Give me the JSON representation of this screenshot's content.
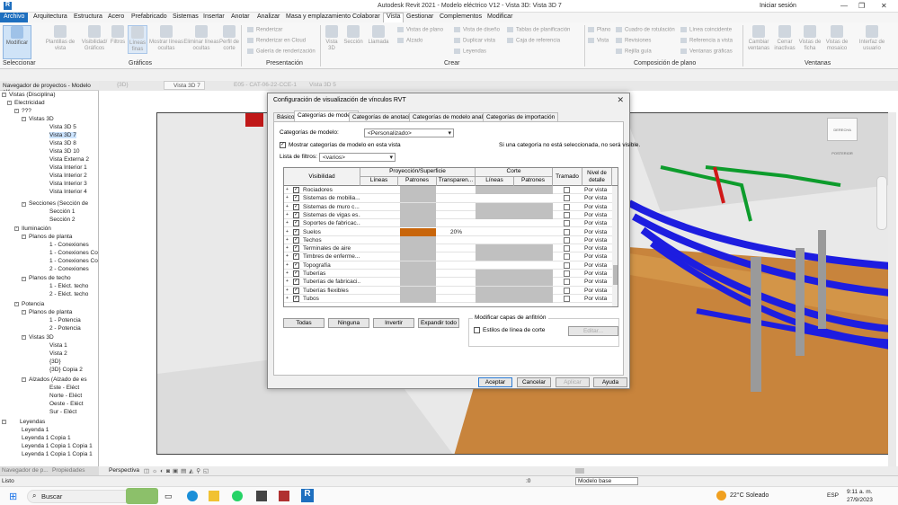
{
  "window": {
    "title": "Autodesk Revit 2021 - Modelo eléctrico V12 - Vista 3D: Vista 3D 7",
    "sign_in": "Iniciar sesión"
  },
  "ribbon_tabs": [
    "Archivo",
    "Arquitectura",
    "Estructura",
    "Acero",
    "Prefabricado",
    "Sistemas",
    "Insertar",
    "Anotar",
    "Analizar",
    "Masa y emplazamiento",
    "Colaborar",
    "Vista",
    "Gestionar",
    "Complementos",
    "Modificar"
  ],
  "ribbon": {
    "modificar": "Modificar",
    "seleccionar": "Seleccionar",
    "graficos": {
      "label": "Gráficos",
      "items": [
        "Plantillas de vista",
        "Visibilidad/ Gráficos",
        "Filtros",
        "Líneas finas",
        "Mostrar líneas ocultas",
        "Eliminar líneas ocultas",
        "Perfil de corte"
      ]
    },
    "presentacion": {
      "label": "Presentación",
      "items": [
        "Renderizar",
        "Renderizar en Cloud",
        "Galería de renderización"
      ]
    },
    "crear": {
      "label": "Crear",
      "big": [
        "Vista 3D",
        "Sección",
        "Llamada"
      ],
      "small": [
        "Vistas de plano",
        "Alzado",
        "Vista de diseño",
        "Duplicar vista",
        "Leyendas",
        "Tablas de planificación",
        "Caja de referencia"
      ]
    },
    "composicion": {
      "label": "Composición de plano",
      "small": [
        "Plano",
        "Vista",
        "Cuadro de rotulación",
        "Revisiones",
        "Rejilla guía",
        "Línea coincidente",
        "Referencia a vista",
        "Ventanas gráficas"
      ]
    },
    "ventanas": {
      "label": "Ventanas",
      "items": [
        "Cambiar ventanas",
        "Cerrar inactivas",
        "Vistas de ficha",
        "Vistas de mosaico",
        "Interfaz de usuario"
      ]
    }
  },
  "view_tabs": [
    "{3D}",
    "Vista 3D 7",
    "E05 - CAT-06-22-CCE-1",
    "Vista 3D 5"
  ],
  "browser": {
    "title": "Navegador de proyectos - Modelo elé...",
    "items": [
      "Vistas (Disciplina)",
      "Electricidad",
      "???",
      "Vistas 3D",
      "Vista 3D 5",
      "Vista 3D 7",
      "Vista 3D 8",
      "Vista 3D 10",
      "Vista Externa 2",
      "Vista Interior 1",
      "Vista Interior 2",
      "Vista Interior 3",
      "Vista Interior 4",
      "Secciones (Sección de",
      "Sección 1",
      "Sección 2",
      "Iluminación",
      "Planos de planta",
      "1 - Conexiones",
      "1 - Conexiones Co",
      "1 - Conexiones Co",
      "2 - Conexiones",
      "Planos de techo",
      "1 - Eléct. techo",
      "2 - Eléct. techo",
      "Potencia",
      "Planos de planta",
      "1 - Potencia",
      "2 - Potencia",
      "Vistas 3D",
      "Vista 1",
      "Vista 2",
      "{3D}",
      "{3D} Copia 2",
      "Alzados (Alzado de es",
      "Este - Eléct",
      "Norte - Eléct",
      "Oeste - Eléct",
      "Sur - Eléct",
      "Leyendas",
      "Leyenda 1",
      "Leyenda 1 Copia 1",
      "Leyenda 1 Copia 1 Copia 1",
      "Leyenda 1 Copia 1 Copia 1"
    ],
    "tabs": [
      "Navegador de p...",
      "Propiedades"
    ]
  },
  "dialog": {
    "title": "Configuración de visualización de vínculos RVT",
    "close": "✕",
    "tabs": [
      "Básicos",
      "Categorías de modelo",
      "Categorías de anotación",
      "Categorías de modelo analítico",
      "Categorías de importación"
    ],
    "model_categories_label": "Categorías de modelo:",
    "model_categories_value": "<Personalizado>",
    "show_label": "Mostrar categorías de modelo en esta vista",
    "note": "Si una categoría no está seleccionada, no será visible.",
    "filter_label": "Lista de filtros:",
    "filter_value": "<varios>",
    "columns": {
      "visibilidad": "Visibilidad",
      "proy": "Proyección/Superficie",
      "corte": "Corte",
      "lineas": "Líneas",
      "patrones": "Patrones",
      "transparencia": "Transparen...",
      "lineas2": "Líneas",
      "patrones2": "Patrones",
      "tramado": "Tramado",
      "nivel": "Nivel de detalle"
    },
    "rows": [
      {
        "name": "Rociadores",
        "detail": "Por vista",
        "cut": true,
        "transp": ""
      },
      {
        "name": "Sistemas de mobilia...",
        "detail": "Por vista",
        "cut": false,
        "transp": ""
      },
      {
        "name": "Sistemas de muro c...",
        "detail": "Por vista",
        "cut": true,
        "transp": ""
      },
      {
        "name": "Sistemas de vigas es...",
        "detail": "Por vista",
        "cut": true,
        "transp": ""
      },
      {
        "name": "Soportes de fabricac...",
        "detail": "Por vista",
        "cut": false,
        "transp": ""
      },
      {
        "name": "Suelos",
        "detail": "Por vista",
        "cut": false,
        "transp": "20%"
      },
      {
        "name": "Techos",
        "detail": "Por vista",
        "cut": false,
        "transp": ""
      },
      {
        "name": "Terminales de aire",
        "detail": "Por vista",
        "cut": true,
        "transp": ""
      },
      {
        "name": "Timbres de enferme...",
        "detail": "Por vista",
        "cut": true,
        "transp": ""
      },
      {
        "name": "Topografía",
        "detail": "Por vista",
        "cut": false,
        "transp": ""
      },
      {
        "name": "Tuberías",
        "detail": "Por vista",
        "cut": true,
        "transp": ""
      },
      {
        "name": "Tuberías de fabricaci...",
        "detail": "Por vista",
        "cut": true,
        "transp": ""
      },
      {
        "name": "Tuberías flexibles",
        "detail": "Por vista",
        "cut": true,
        "transp": ""
      },
      {
        "name": "Tubos",
        "detail": "Por vista",
        "cut": true,
        "transp": ""
      }
    ],
    "buttons": {
      "todas": "Todas",
      "ninguna": "Ninguna",
      "invertir": "Invertir",
      "expandir": "Expandir todo"
    },
    "host_group": "Modificar capas de anfitrión",
    "line_styles": "Estilos de línea de corte",
    "editar": "Editar...",
    "footer": {
      "aceptar": "Aceptar",
      "cancelar": "Cancelar",
      "aplicar": "Aplicar",
      "ayuda": "Ayuda"
    },
    "colors": {
      "suelos_pattern": "#c8650a"
    }
  },
  "viewcube": {
    "left": "DERECHA",
    "right": "POSTERIOR"
  },
  "view_control": "Perspectiva",
  "status": {
    "text": "Listo",
    "model": "Modelo base",
    "zero": ":0"
  },
  "taskbar": {
    "search": "Buscar",
    "weather": "22°C Soleado",
    "lang": "ESP",
    "time": "9:11 a. m.",
    "date": "27/9/2023"
  }
}
